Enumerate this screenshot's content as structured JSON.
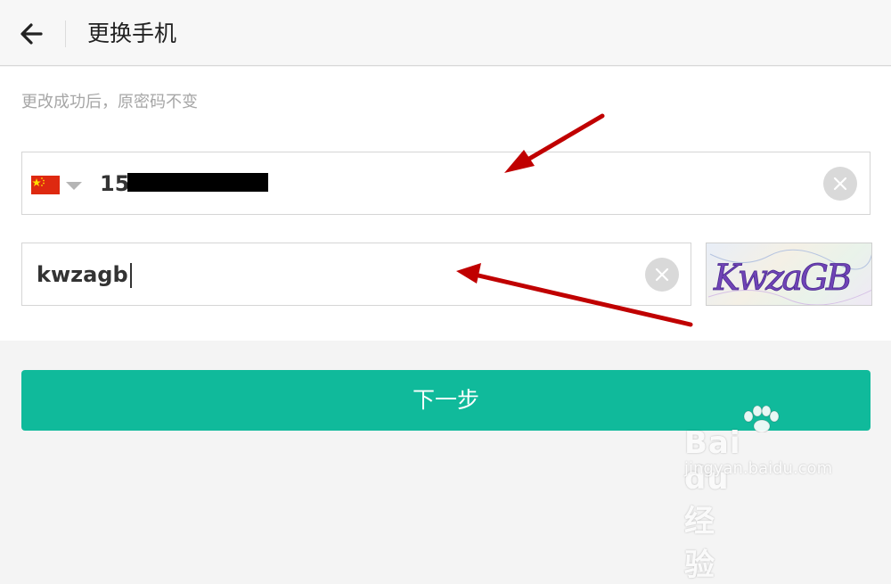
{
  "header": {
    "title": "更换手机",
    "back_icon": "arrow-left-icon"
  },
  "hint": "更改成功后，原密码不变",
  "phone": {
    "country_flag": "flag-china-icon",
    "value": "15"
  },
  "captcha_input": {
    "value": "kwzagb"
  },
  "captcha_image": {
    "text": "KwzaGB"
  },
  "next_button": {
    "label": "下一步"
  },
  "watermark": {
    "brand": "Bai du 经验",
    "url": "jingyan.baidu.com"
  },
  "colors": {
    "primary": "#10ba9b",
    "annotation_arrow": "#c00000"
  }
}
